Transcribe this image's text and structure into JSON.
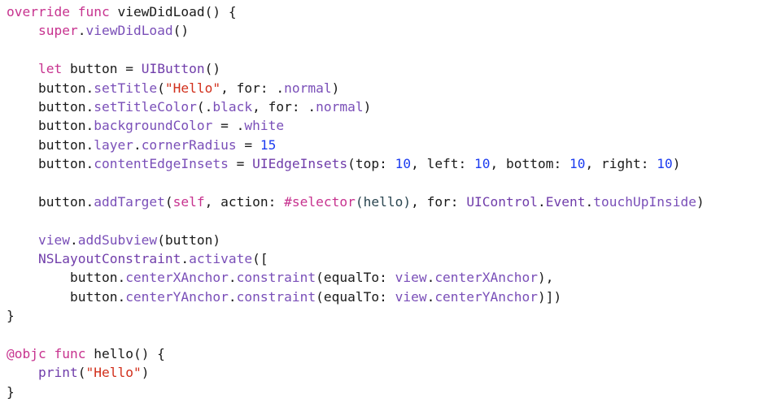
{
  "editor": {
    "language": "swift",
    "colors": {
      "keyword": "#c7338f",
      "string": "#d12f1b",
      "number": "#1c3cf0",
      "type": "#703daa",
      "method": "#7a4fb8",
      "plain": "#1a1a1a",
      "background": "#ffffff"
    },
    "lines": [
      [
        {
          "t": "kw",
          "v": "override func"
        },
        {
          "t": "plain",
          "v": " viewDidLoad() {"
        }
      ],
      [
        {
          "t": "plain",
          "v": "    "
        },
        {
          "t": "kw",
          "v": "super"
        },
        {
          "t": "plain",
          "v": "."
        },
        {
          "t": "meth",
          "v": "viewDidLoad"
        },
        {
          "t": "plain",
          "v": "()"
        }
      ],
      [],
      [
        {
          "t": "plain",
          "v": "    "
        },
        {
          "t": "kw",
          "v": "let"
        },
        {
          "t": "plain",
          "v": " button = "
        },
        {
          "t": "type",
          "v": "UIButton"
        },
        {
          "t": "plain",
          "v": "()"
        }
      ],
      [
        {
          "t": "plain",
          "v": "    button."
        },
        {
          "t": "meth",
          "v": "setTitle"
        },
        {
          "t": "plain",
          "v": "("
        },
        {
          "t": "str",
          "v": "\"Hello\""
        },
        {
          "t": "plain",
          "v": ", for: ."
        },
        {
          "t": "meth",
          "v": "normal"
        },
        {
          "t": "plain",
          "v": ")"
        }
      ],
      [
        {
          "t": "plain",
          "v": "    button."
        },
        {
          "t": "meth",
          "v": "setTitleColor"
        },
        {
          "t": "plain",
          "v": "(."
        },
        {
          "t": "meth",
          "v": "black"
        },
        {
          "t": "plain",
          "v": ", for: ."
        },
        {
          "t": "meth",
          "v": "normal"
        },
        {
          "t": "plain",
          "v": ")"
        }
      ],
      [
        {
          "t": "plain",
          "v": "    button."
        },
        {
          "t": "meth",
          "v": "backgroundColor"
        },
        {
          "t": "plain",
          "v": " = ."
        },
        {
          "t": "meth",
          "v": "white"
        }
      ],
      [
        {
          "t": "plain",
          "v": "    button."
        },
        {
          "t": "meth",
          "v": "layer"
        },
        {
          "t": "plain",
          "v": "."
        },
        {
          "t": "meth",
          "v": "cornerRadius"
        },
        {
          "t": "plain",
          "v": " = "
        },
        {
          "t": "num",
          "v": "15"
        }
      ],
      [
        {
          "t": "plain",
          "v": "    button."
        },
        {
          "t": "meth",
          "v": "contentEdgeInsets"
        },
        {
          "t": "plain",
          "v": " = "
        },
        {
          "t": "type",
          "v": "UIEdgeInsets"
        },
        {
          "t": "plain",
          "v": "(top: "
        },
        {
          "t": "num",
          "v": "10"
        },
        {
          "t": "plain",
          "v": ", left: "
        },
        {
          "t": "num",
          "v": "10"
        },
        {
          "t": "plain",
          "v": ", bottom: "
        },
        {
          "t": "num",
          "v": "10"
        },
        {
          "t": "plain",
          "v": ", right: "
        },
        {
          "t": "num",
          "v": "10"
        },
        {
          "t": "plain",
          "v": ")"
        }
      ],
      [],
      [
        {
          "t": "plain",
          "v": "    button."
        },
        {
          "t": "meth",
          "v": "addTarget"
        },
        {
          "t": "plain",
          "v": "("
        },
        {
          "t": "kw",
          "v": "self"
        },
        {
          "t": "plain",
          "v": ", action: "
        },
        {
          "t": "kw",
          "v": "#selector"
        },
        {
          "t": "param",
          "v": "(hello)"
        },
        {
          "t": "plain",
          "v": ", for: "
        },
        {
          "t": "type",
          "v": "UIControl"
        },
        {
          "t": "plain",
          "v": "."
        },
        {
          "t": "type",
          "v": "Event"
        },
        {
          "t": "plain",
          "v": "."
        },
        {
          "t": "meth",
          "v": "touchUpInside"
        },
        {
          "t": "plain",
          "v": ")"
        }
      ],
      [],
      [
        {
          "t": "plain",
          "v": "    "
        },
        {
          "t": "meth",
          "v": "view"
        },
        {
          "t": "plain",
          "v": "."
        },
        {
          "t": "meth",
          "v": "addSubview"
        },
        {
          "t": "plain",
          "v": "(button)"
        }
      ],
      [
        {
          "t": "plain",
          "v": "    "
        },
        {
          "t": "type",
          "v": "NSLayoutConstraint"
        },
        {
          "t": "plain",
          "v": "."
        },
        {
          "t": "meth",
          "v": "activate"
        },
        {
          "t": "plain",
          "v": "(["
        }
      ],
      [
        {
          "t": "plain",
          "v": "        button."
        },
        {
          "t": "meth",
          "v": "centerXAnchor"
        },
        {
          "t": "plain",
          "v": "."
        },
        {
          "t": "meth",
          "v": "constraint"
        },
        {
          "t": "plain",
          "v": "(equalTo: "
        },
        {
          "t": "meth",
          "v": "view"
        },
        {
          "t": "plain",
          "v": "."
        },
        {
          "t": "meth",
          "v": "centerXAnchor"
        },
        {
          "t": "plain",
          "v": "),"
        }
      ],
      [
        {
          "t": "plain",
          "v": "        button."
        },
        {
          "t": "meth",
          "v": "centerYAnchor"
        },
        {
          "t": "plain",
          "v": "."
        },
        {
          "t": "meth",
          "v": "constraint"
        },
        {
          "t": "plain",
          "v": "(equalTo: "
        },
        {
          "t": "meth",
          "v": "view"
        },
        {
          "t": "plain",
          "v": "."
        },
        {
          "t": "meth",
          "v": "centerYAnchor"
        },
        {
          "t": "plain",
          "v": ")])"
        }
      ],
      [
        {
          "t": "plain",
          "v": "}"
        }
      ],
      [],
      [
        {
          "t": "kw",
          "v": "@objc func"
        },
        {
          "t": "plain",
          "v": " hello() {"
        }
      ],
      [
        {
          "t": "plain",
          "v": "    "
        },
        {
          "t": "type",
          "v": "print"
        },
        {
          "t": "plain",
          "v": "("
        },
        {
          "t": "str",
          "v": "\"Hello\""
        },
        {
          "t": "plain",
          "v": ")"
        }
      ],
      [
        {
          "t": "plain",
          "v": "}"
        }
      ]
    ]
  }
}
